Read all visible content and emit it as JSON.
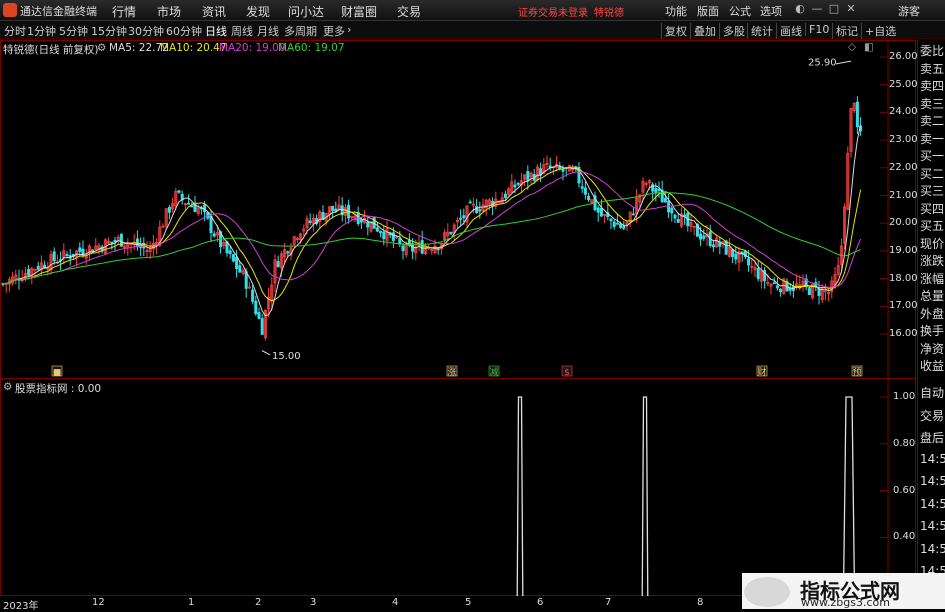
{
  "app": {
    "name": "通达信金融终端",
    "notice": "证券交易未登录",
    "stock_link": "特锐德",
    "guest": "游客"
  },
  "menu": [
    "行情",
    "市场",
    "资讯",
    "发现",
    "问小达",
    "财富圈",
    "交易"
  ],
  "right_menu": [
    "功能",
    "版面",
    "公式",
    "选项"
  ],
  "periods": [
    "分时",
    "1分钟",
    "5分钟",
    "15分钟",
    "30分钟",
    "60分钟",
    "日线",
    "周线",
    "月线",
    "多周期",
    "更多"
  ],
  "active_period": "日线",
  "tools": [
    "复权",
    "叠加",
    "多股",
    "统计",
    "画线",
    "F10",
    "标记",
    "+自选"
  ],
  "main_chart": {
    "title": "特锐德(日线 前复权)",
    "ma5": "MA5: 22.72",
    "ma10": "MA10: 20.47",
    "ma20": "MA20: 19.00",
    "ma60": "MA60: 19.07",
    "colors": {
      "up": "#ff4040",
      "down": "#34e0e8",
      "ma5": "#dddddd",
      "ma10": "#e8e800",
      "ma20": "#d040d0",
      "ma60": "#30d030"
    },
    "y_ticks": [
      "26.00",
      "25.00",
      "24.00",
      "23.00",
      "22.00",
      "21.00",
      "20.00",
      "19.00",
      "18.00",
      "17.00",
      "16.00"
    ],
    "high_label": "25.90",
    "low_label": "15.00",
    "markers": [
      "■",
      "涨",
      "减",
      "$",
      "财",
      "预"
    ]
  },
  "indicator": {
    "title": "股票指标网 : 0.00",
    "y_ticks": [
      "1.00",
      "0.80",
      "0.60",
      "0.40"
    ]
  },
  "x_labels": [
    "2023年",
    "12",
    "1",
    "2",
    "3",
    "4",
    "5",
    "6",
    "7",
    "8",
    "9"
  ],
  "side_panel": [
    "委比",
    "卖五",
    "卖四",
    "卖三",
    "卖二",
    "卖一",
    "买一",
    "买二",
    "买三",
    "买四",
    "买五",
    "现价",
    "涨跌",
    "涨幅",
    "总量",
    "外盘",
    "换手",
    "净资",
    "收益"
  ],
  "side_panel2": [
    "自动",
    "交易",
    "盘后",
    "14:50",
    "14:50",
    "14:50",
    "14:50",
    "14:50",
    "14:50"
  ],
  "watermark": {
    "title": "指标公式网",
    "url": "www.zbgs3.com"
  }
}
